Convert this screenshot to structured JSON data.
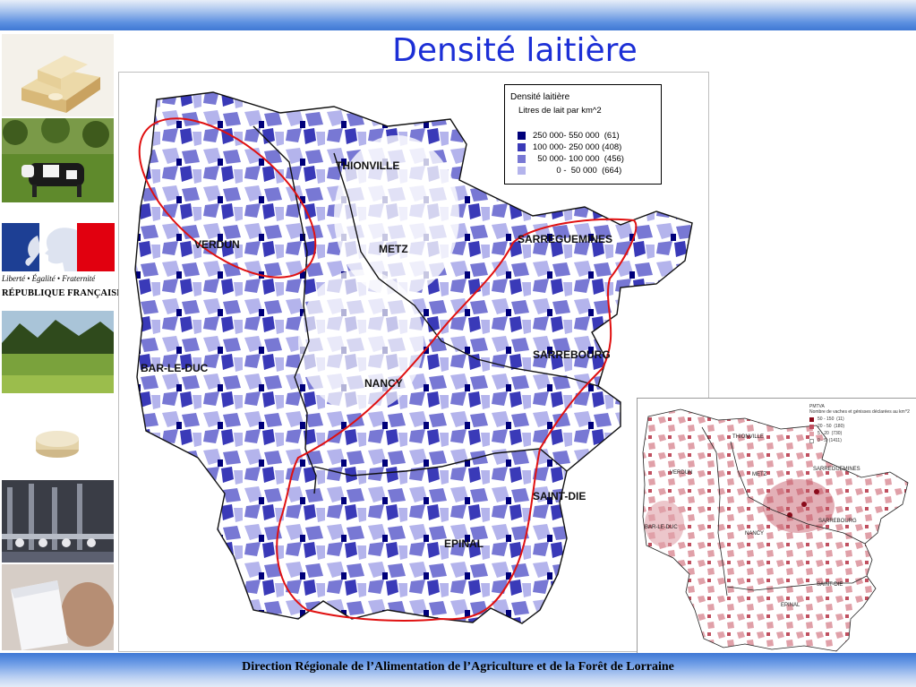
{
  "slide": {
    "title": "Densité laitière",
    "footer": "Direction Régionale de l’Alimentation de l’Agriculture et de la Forêt de Lorraine"
  },
  "sidebar": {
    "photos": [
      "cheese-photo",
      "cows-orchard-photo",
      "republique-francaise-logo",
      "pasture-photo",
      "round-cheese-photo",
      "milking-parlour-photo",
      "milk-glass-photo"
    ],
    "logo": {
      "motto": "Liberté • Égalité • Fraternité",
      "name": "RÉPUBLIQUE FRANÇAISE"
    }
  },
  "main_map": {
    "legend": {
      "title": "Densité laitière",
      "subtitle": "Litres de lait par km^2",
      "classes": [
        {
          "range": "250 000- 550 000",
          "count": "(61)",
          "color": "#00007a"
        },
        {
          "range": "100 000- 250 000",
          "count": "(408)",
          "color": "#3a3ab8"
        },
        {
          "range": "50 000- 100 000",
          "count": "(456)",
          "color": "#7878d4"
        },
        {
          "range": "0 -  50 000",
          "count": "(664)",
          "color": "#b4b4ec"
        }
      ]
    },
    "cities": [
      "THIONVILLE",
      "VERDUN",
      "METZ",
      "SARREGUEMINES",
      "BAR-LE-DUC",
      "NANCY",
      "SARREBOURG",
      "SAINT-DIE",
      "EPINAL"
    ],
    "highlight_color": "#e01010"
  },
  "inset_map": {
    "legend": {
      "title": "PMTVA",
      "subtitle": "Nombre de vaches et génisses déclarées au km^2",
      "classes": [
        {
          "range": "50 - 150",
          "count": "(11)",
          "color": "#8a0a1a"
        },
        {
          "range": "20 - 50",
          "count": "(180)",
          "color": "#c05060"
        },
        {
          "range": "5 - 20",
          "count": "(730)",
          "color": "#e0a0a8"
        },
        {
          "range": "0 - 5",
          "count": "(1411)",
          "color": "#ffffff"
        }
      ]
    },
    "cities": [
      "THIONVILLE",
      "VERDUN",
      "METZ",
      "SARREGUEMINES",
      "BAR-LE-DUC",
      "SARREBOURG",
      "NANCY",
      "SAINT-DIE",
      "EPINAL"
    ]
  }
}
